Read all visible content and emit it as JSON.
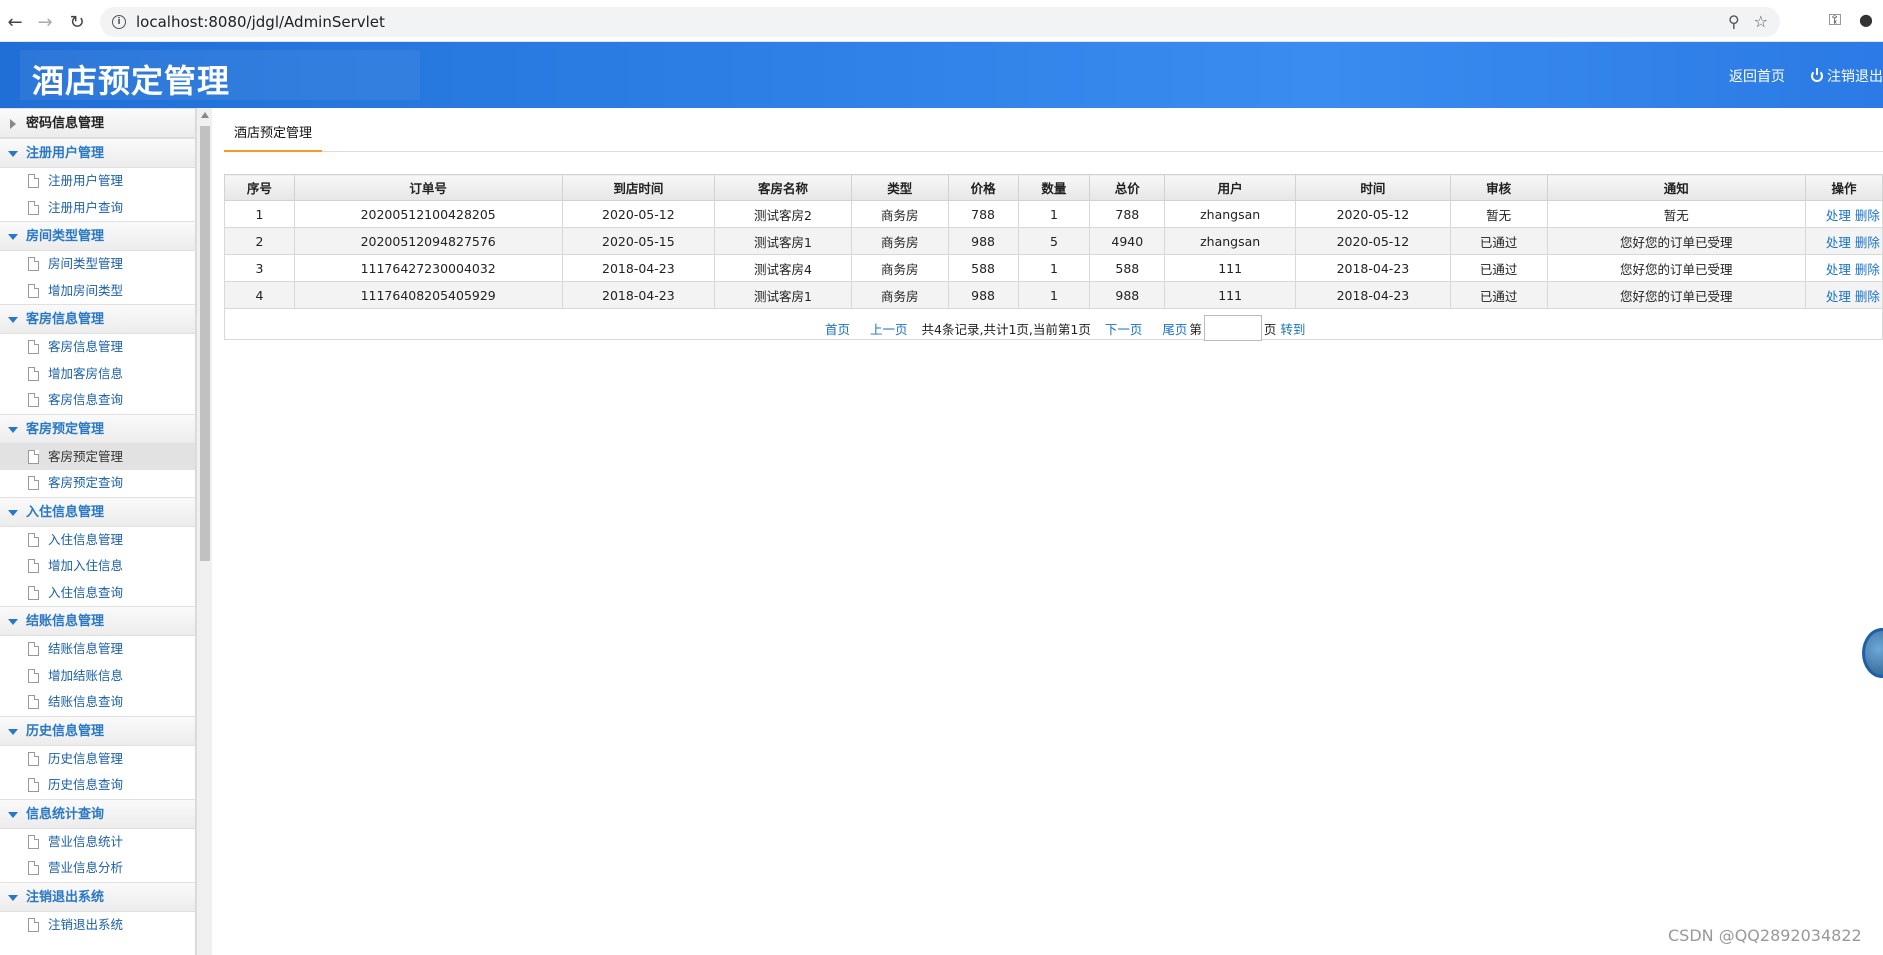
{
  "browser": {
    "url": "localhost:8080/jdgl/AdminServlet"
  },
  "header": {
    "title": "酒店预定管理",
    "links": [
      "返回首页",
      "注销退出"
    ]
  },
  "sidebar": {
    "groups": [
      {
        "label": "密码信息管理",
        "collapsed": true,
        "items": []
      },
      {
        "label": "注册用户管理",
        "items": [
          "注册用户管理",
          "注册用户查询"
        ]
      },
      {
        "label": "房间类型管理",
        "items": [
          "房间类型管理",
          "增加房间类型"
        ]
      },
      {
        "label": "客房信息管理",
        "items": [
          "客房信息管理",
          "增加客房信息",
          "客房信息查询"
        ]
      },
      {
        "label": "客房预定管理",
        "items": [
          "客房预定管理",
          "客房预定查询"
        ]
      },
      {
        "label": "入住信息管理",
        "items": [
          "入住信息管理",
          "增加入住信息",
          "入住信息查询"
        ]
      },
      {
        "label": "结账信息管理",
        "items": [
          "结账信息管理",
          "增加结账信息",
          "结账信息查询"
        ]
      },
      {
        "label": "历史信息管理",
        "items": [
          "历史信息管理",
          "历史信息查询"
        ]
      },
      {
        "label": "信息统计查询",
        "items": [
          "营业信息统计",
          "营业信息分析"
        ]
      },
      {
        "label": "注销退出系统",
        "items": [
          "注销退出系统"
        ]
      }
    ],
    "active": "客房预定管理"
  },
  "main": {
    "tab": "酒店预定管理",
    "columns": [
      "序号",
      "订单号",
      "到店时间",
      "客房名称",
      "类型",
      "价格",
      "数量",
      "总价",
      "用户",
      "时间",
      "审核",
      "通知",
      "操作"
    ],
    "rows": [
      [
        "1",
        "20200512100428205",
        "2020-05-12",
        "测试客房2",
        "商务房",
        "788",
        "1",
        "788",
        "zhangsan",
        "2020-05-12",
        "暂无",
        "暂无"
      ],
      [
        "2",
        "20200512094827576",
        "2020-05-15",
        "测试客房1",
        "商务房",
        "988",
        "5",
        "4940",
        "zhangsan",
        "2020-05-12",
        "已通过",
        "您好您的订单已受理"
      ],
      [
        "3",
        "11176427230004032",
        "2018-04-23",
        "测试客房4",
        "商务房",
        "588",
        "1",
        "588",
        "111",
        "2018-04-23",
        "已通过",
        "您好您的订单已受理"
      ],
      [
        "4",
        "11176408205405929",
        "2018-04-23",
        "测试客房1",
        "商务房",
        "988",
        "1",
        "988",
        "111",
        "2018-04-23",
        "已通过",
        "您好您的订单已受理"
      ]
    ],
    "row_actions": [
      "处理",
      "删除"
    ],
    "pager": {
      "first": "首页",
      "prev": "上一页",
      "info": "共4条记录,共计1页,当前第1页",
      "next": "下一页",
      "last": "尾页",
      "page_prefix": "第",
      "page_suffix": "页",
      "goto": "转到"
    }
  },
  "watermark": "CSDN @QQ2892034822"
}
